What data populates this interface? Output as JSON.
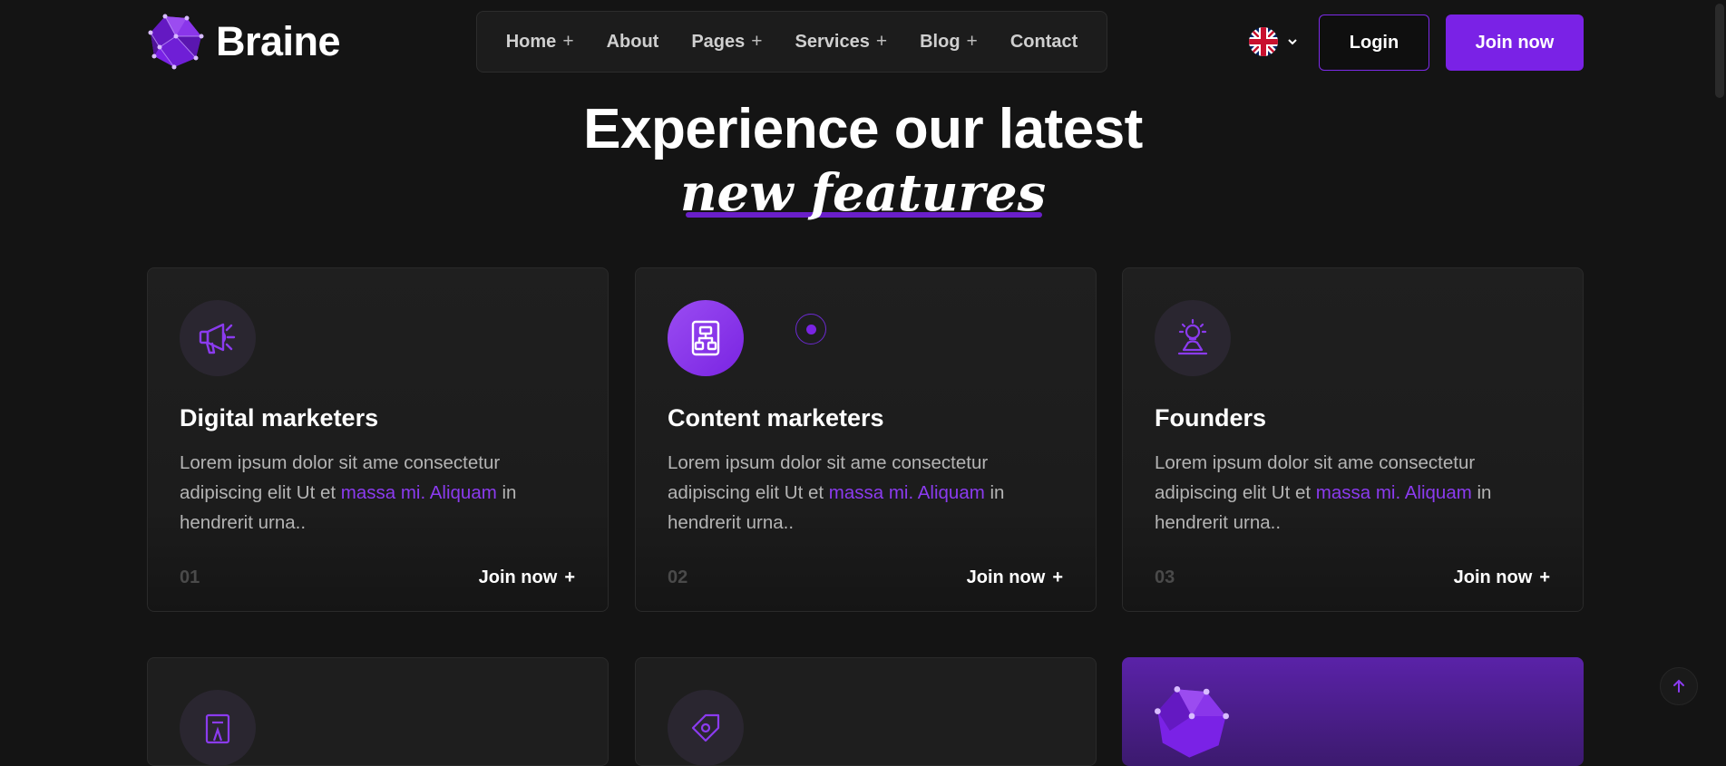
{
  "brand": {
    "name": "Braine",
    "accent": "#7a22e6"
  },
  "nav": {
    "items": [
      {
        "label": "Home",
        "plus": "+"
      },
      {
        "label": "About",
        "plus": ""
      },
      {
        "label": "Pages",
        "plus": "+"
      },
      {
        "label": "Services",
        "plus": "+"
      },
      {
        "label": "Blog",
        "plus": "+"
      },
      {
        "label": "Contact",
        "plus": ""
      }
    ]
  },
  "header": {
    "login_label": "Login",
    "join_label": "Join now",
    "language_icon": "uk-flag-icon"
  },
  "headline": {
    "line1": "Experience our latest",
    "line2": "new features"
  },
  "cards": [
    {
      "title": "Digital marketers",
      "desc_before": "Lorem ipsum dolor sit ame consectetur adipiscing elit Ut et ",
      "desc_highlight": "massa mi. Aliquam",
      "desc_after": " in hendrerit urna..",
      "number": "01",
      "link": "Join now",
      "link_plus": "+",
      "icon": "megaphone-icon"
    },
    {
      "title": "Content marketers",
      "desc_before": "Lorem ipsum dolor sit ame consectetur adipiscing elit Ut et ",
      "desc_highlight": "massa mi. Aliquam",
      "desc_after": " in hendrerit urna..",
      "number": "02",
      "link": "Join now",
      "link_plus": "+",
      "icon": "flowchart-icon"
    },
    {
      "title": "Founders",
      "desc_before": "Lorem ipsum dolor sit ame consectetur adipiscing elit Ut et ",
      "desc_highlight": "massa mi. Aliquam",
      "desc_after": " in hendrerit urna..",
      "number": "03",
      "link": "Join now",
      "link_plus": "+",
      "icon": "idea-person-icon"
    }
  ]
}
